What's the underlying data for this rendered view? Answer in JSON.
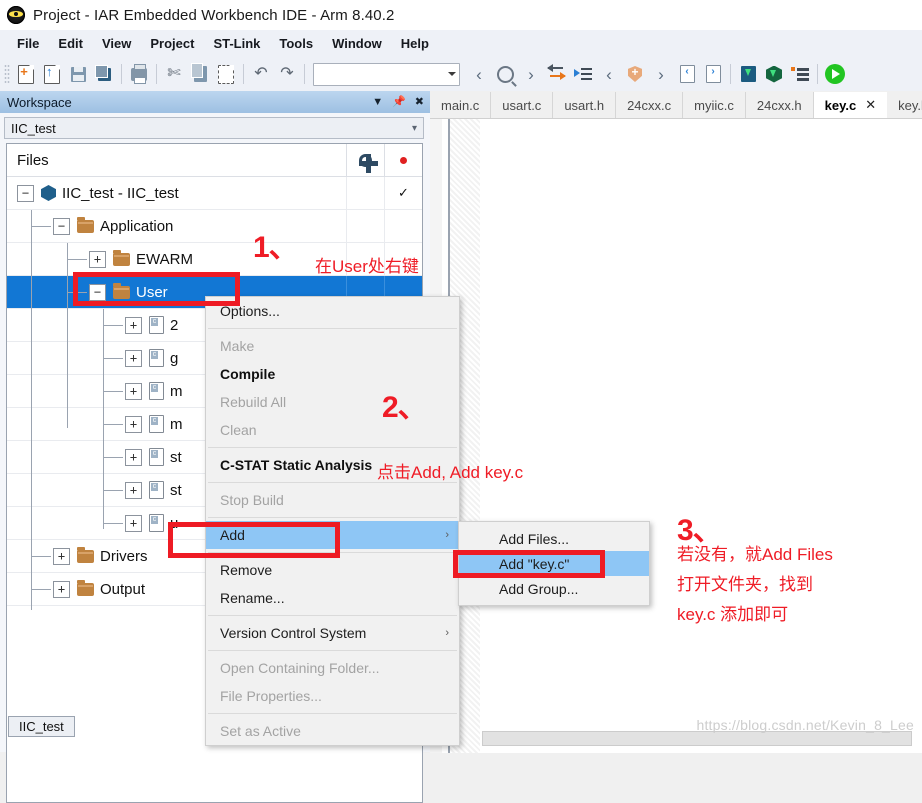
{
  "window": {
    "title": "Project - IAR Embedded Workbench IDE - Arm 8.40.2",
    "icon": "iar-app-icon"
  },
  "menubar": {
    "items": [
      {
        "label": "File"
      },
      {
        "label": "Edit"
      },
      {
        "label": "View"
      },
      {
        "label": "Project"
      },
      {
        "label": "ST-Link"
      },
      {
        "label": "Tools"
      },
      {
        "label": "Window"
      },
      {
        "label": "Help"
      }
    ]
  },
  "toolbar": {
    "combo_value": "",
    "icons": [
      "new-document-icon",
      "open-document-icon",
      "save-icon",
      "save-all-icon",
      "print-icon",
      "cut-icon",
      "copy-icon",
      "paste-icon",
      "undo-icon",
      "redo-icon",
      "navigate-back-icon",
      "find-icon",
      "navigate-forward-icon",
      "toggle-bookmark-icon",
      "go-to-definition-icon",
      "previous-bookmark-icon",
      "compile-icon",
      "next-bookmark-icon",
      "previous-error-icon",
      "next-error-icon",
      "download-debug-icon",
      "download-active-app-icon",
      "make-and-restart-icon",
      "run-icon"
    ]
  },
  "workspace": {
    "header_title": "Workspace",
    "header_icons": [
      "dropdown-icon",
      "pin-icon",
      "close-icon"
    ],
    "selected_project": "IIC_test",
    "files_column_label": "Files",
    "bottom_tab": "IIC_test",
    "tree": [
      {
        "label": "IIC_test - IIC_test",
        "icon": "project-cube-icon",
        "expander": "−",
        "indent": 0,
        "col2": "✓",
        "selected": false
      },
      {
        "label": "Application",
        "icon": "folder-icon",
        "expander": "−",
        "indent": 1,
        "col2": "",
        "selected": false
      },
      {
        "label": "EWARM",
        "icon": "folder-icon",
        "expander": "+",
        "indent": 2,
        "col2": "",
        "selected": false
      },
      {
        "label": "User",
        "icon": "folder-icon",
        "expander": "−",
        "indent": 2,
        "col2": "",
        "selected": true
      },
      {
        "label": "2",
        "icon": "c-file-icon",
        "expander": "+",
        "indent": 3,
        "col2": "",
        "selected": false
      },
      {
        "label": "g",
        "icon": "c-file-icon",
        "expander": "+",
        "indent": 3,
        "col2": "",
        "selected": false
      },
      {
        "label": "m",
        "icon": "c-file-icon",
        "expander": "+",
        "indent": 3,
        "col2": "",
        "selected": false
      },
      {
        "label": "m",
        "icon": "c-file-icon",
        "expander": "+",
        "indent": 3,
        "col2": "",
        "selected": false
      },
      {
        "label": "st",
        "icon": "c-file-icon",
        "expander": "+",
        "indent": 3,
        "col2": "",
        "selected": false
      },
      {
        "label": "st",
        "icon": "c-file-icon",
        "expander": "+",
        "indent": 3,
        "col2": "",
        "selected": false
      },
      {
        "label": "u",
        "icon": "c-file-icon",
        "expander": "+",
        "indent": 3,
        "col2": "",
        "selected": false
      },
      {
        "label": "Drivers",
        "icon": "folder-icon",
        "expander": "+",
        "indent": 1,
        "col2": "",
        "selected": false
      },
      {
        "label": "Output",
        "icon": "folder-icon",
        "expander": "+",
        "indent": 1,
        "col2": "",
        "selected": false
      }
    ]
  },
  "editor": {
    "tabs": [
      {
        "label": "main.c",
        "active": false
      },
      {
        "label": "usart.c",
        "active": false
      },
      {
        "label": "usart.h",
        "active": false
      },
      {
        "label": "24cxx.c",
        "active": false
      },
      {
        "label": "myiic.c",
        "active": false
      },
      {
        "label": "24cxx.h",
        "active": false
      },
      {
        "label": "key.c",
        "active": true
      },
      {
        "label": "key.h",
        "active": false
      }
    ],
    "active_tab_close": "✕",
    "watermark": "https://blog.csdn.net/Kevin_8_Lee"
  },
  "context_menu": {
    "items": [
      {
        "label": "Options...",
        "state": "normal",
        "submenu": false,
        "highlight": false
      },
      {
        "type": "separator"
      },
      {
        "label": "Make",
        "state": "disabled",
        "submenu": false,
        "highlight": false
      },
      {
        "label": "Compile",
        "state": "bold",
        "submenu": false,
        "highlight": false
      },
      {
        "label": "Rebuild All",
        "state": "disabled",
        "submenu": false,
        "highlight": false
      },
      {
        "label": "Clean",
        "state": "disabled",
        "submenu": false,
        "highlight": false
      },
      {
        "type": "separator"
      },
      {
        "label": "C-STAT Static Analysis",
        "state": "bold",
        "submenu": false,
        "highlight": false
      },
      {
        "type": "separator"
      },
      {
        "label": "Stop Build",
        "state": "disabled",
        "submenu": false,
        "highlight": false
      },
      {
        "type": "separator"
      },
      {
        "label": "Add",
        "state": "normal",
        "submenu": true,
        "highlight": true
      },
      {
        "type": "separator"
      },
      {
        "label": "Remove",
        "state": "normal",
        "submenu": false,
        "highlight": false
      },
      {
        "label": "Rename...",
        "state": "normal",
        "submenu": false,
        "highlight": false
      },
      {
        "type": "separator"
      },
      {
        "label": "Version Control System",
        "state": "normal",
        "submenu": true,
        "highlight": false
      },
      {
        "type": "separator"
      },
      {
        "label": "Open Containing Folder...",
        "state": "disabled",
        "submenu": false,
        "highlight": false
      },
      {
        "label": "File Properties...",
        "state": "disabled",
        "submenu": false,
        "highlight": false
      },
      {
        "type": "separator"
      },
      {
        "label": "Set as Active",
        "state": "disabled",
        "submenu": false,
        "highlight": false
      }
    ],
    "submenu_arrow": "›"
  },
  "add_submenu": {
    "items": [
      {
        "label": "Add Files...",
        "highlight": false
      },
      {
        "label": "Add \"key.c\"",
        "highlight": true
      },
      {
        "label": "Add Group...",
        "highlight": false
      }
    ]
  },
  "annotations": {
    "accent_color": "#ee1b24",
    "step1_number": "1、",
    "step1_text": "在User处右键",
    "step2_number": "2、",
    "step2_text": "点击Add, Add key.c",
    "step3_number": "3、",
    "step3_line1": "若没有，就Add Files",
    "step3_line2": "打开文件夹，找到",
    "step3_line3": "key.c 添加即可"
  }
}
